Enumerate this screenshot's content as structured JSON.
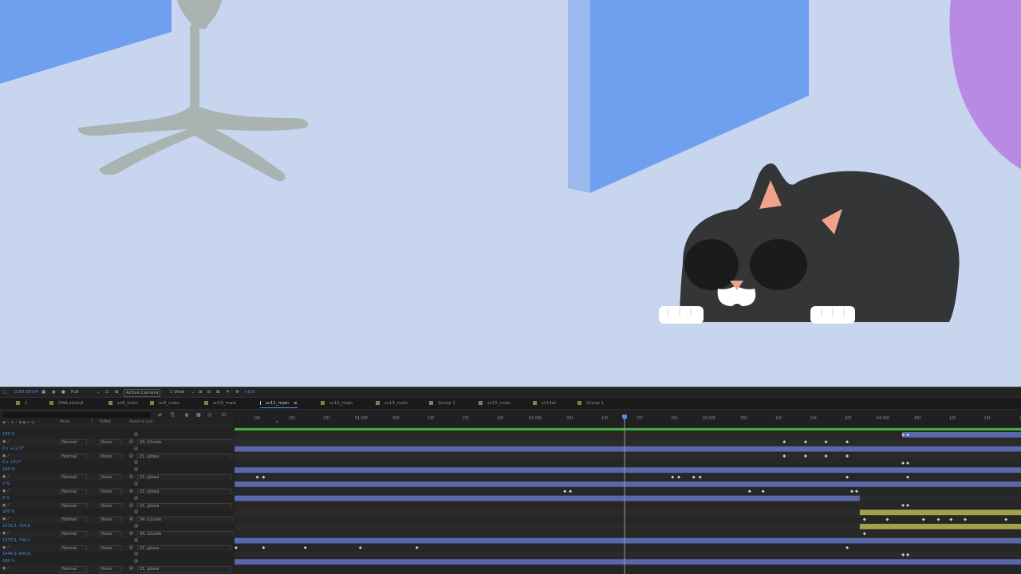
{
  "viewer": {
    "timecode": "0:00:00:04",
    "resolution": "Full",
    "camera": "Active Camera",
    "views": "1 View",
    "exposure": "+0,0"
  },
  "tabs": [
    {
      "label": "1"
    },
    {
      "label": "DNA.strand"
    },
    {
      "label": "sc8_main"
    },
    {
      "label": "sc9_main"
    },
    {
      "label": "sc10_main"
    },
    {
      "label": "sc11_main",
      "active": true
    },
    {
      "label": "sc12_main"
    },
    {
      "label": "sc13_main"
    },
    {
      "label": "Group 1"
    },
    {
      "label": "sc15_main"
    },
    {
      "label": "sc14el"
    },
    {
      "label": "Group 1"
    }
  ],
  "columns": {
    "mode": "Mode",
    "t": "T",
    "trkmat": "TrkMat",
    "parent": "Parent & Link"
  },
  "rows": [
    {
      "type": "prop",
      "value": "100 %"
    },
    {
      "type": "layer",
      "mode": "Normal",
      "trkmat": "None",
      "parent": "34. k2ciało"
    },
    {
      "type": "prop",
      "value": "0 x +12,0°"
    },
    {
      "type": "layer",
      "mode": "Normal",
      "trkmat": "None",
      "parent": "21. glowa"
    },
    {
      "type": "prop",
      "value": "0 x +0,0°"
    },
    {
      "type": "prop",
      "value": "100 %"
    },
    {
      "type": "layer",
      "mode": "Normal",
      "trkmat": "None",
      "parent": "21. glowa"
    },
    {
      "type": "prop",
      "value": "0 %"
    },
    {
      "type": "layer",
      "mode": "Normal",
      "trkmat": "None",
      "parent": "21. glowa"
    },
    {
      "type": "prop",
      "value": "0 %"
    },
    {
      "type": "layer",
      "mode": "Normal",
      "trkmat": "None",
      "parent": "21. glowa"
    },
    {
      "type": "prop",
      "value": "100 %"
    },
    {
      "type": "layer",
      "mode": "Normal",
      "trkmat": "None",
      "parent": "34. k2ciało"
    },
    {
      "type": "prop",
      "value": "1373,5, 754,6"
    },
    {
      "type": "layer",
      "mode": "Normal",
      "trkmat": "None",
      "parent": "34. k2ciało"
    },
    {
      "type": "prop",
      "value": "1373,6, 749,2"
    },
    {
      "type": "layer",
      "mode": "Normal",
      "trkmat": "None",
      "parent": "21. glowa"
    },
    {
      "type": "prop",
      "value": "1444,0, 844,0"
    },
    {
      "type": "prop",
      "value": "100 %"
    },
    {
      "type": "layer",
      "mode": "Normal",
      "trkmat": "None",
      "parent": "21. glowa"
    }
  ],
  "ruler_ticks": [
    "10f",
    "15f",
    "20f",
    "01:00f",
    "05f",
    "10f",
    "15f",
    "20f",
    "02:00f",
    "05f",
    "10f",
    "15f",
    "20f",
    "03:00f",
    "05f",
    "10f",
    "15f",
    "20f",
    "04:00f",
    "05f",
    "10f",
    "15f",
    "20"
  ],
  "timeline": {
    "playhead_frame": 4,
    "tracks": [
      {
        "bar": "blue",
        "start": 0.849,
        "end": 1.0,
        "keys": [
          0.85,
          0.856
        ]
      },
      {
        "bar": null,
        "keys": [
          0.699,
          0.726,
          0.752,
          0.779
        ]
      },
      {
        "bar": "blue",
        "start": 0.0,
        "end": 1.0,
        "keys": []
      },
      {
        "bar": null,
        "keys": [
          0.699,
          0.726,
          0.752,
          0.779
        ]
      },
      {
        "bar": null,
        "keys": [
          0.85,
          0.856
        ]
      },
      {
        "bar": "blue",
        "start": 0.0,
        "end": 1.0,
        "keys": []
      },
      {
        "bar": null,
        "keys": [
          0.029,
          0.037,
          0.557,
          0.565,
          0.584,
          0.592,
          0.779,
          0.856
        ]
      },
      {
        "bar": "blue",
        "start": 0.0,
        "end": 1.0,
        "keys": []
      },
      {
        "bar": null,
        "keys": [
          0.42,
          0.427,
          0.655,
          0.672,
          0.785,
          0.791
        ]
      },
      {
        "bar": "blue",
        "start": 0.0,
        "end": 0.795,
        "keys": []
      },
      {
        "bar": null,
        "keys": [
          0.85,
          0.856
        ]
      },
      {
        "bar": "yellow",
        "start": 0.795,
        "end": 1.0,
        "keys": []
      },
      {
        "bar": null,
        "keys": [
          0.801,
          0.83,
          0.876,
          0.895,
          0.911,
          0.929,
          0.981
        ]
      },
      {
        "bar": "yellow",
        "start": 0.795,
        "end": 1.0,
        "keys": []
      },
      {
        "bar": null,
        "keys": [
          0.801
        ]
      },
      {
        "bar": "blue",
        "start": 0.0,
        "end": 1.0,
        "keys": []
      },
      {
        "bar": null,
        "keys": [
          0.002,
          0.037,
          0.09,
          0.16,
          0.232,
          0.779
        ]
      },
      {
        "bar": null,
        "keys": [
          0.85,
          0.856
        ]
      },
      {
        "bar": "blue",
        "start": 0.0,
        "end": 1.0,
        "keys": []
      }
    ]
  },
  "colors": {
    "background": "#c7d5ef",
    "panel_blue": "#6fa0ef",
    "panel_side": "#9cb9ee",
    "cat_body": "#333536",
    "cat_ear": "#f0a28c",
    "purple": "#b98ae3",
    "chair": "#a9b4b2",
    "bar_blue": "#5a67a8",
    "bar_yellow": "#a3a14a",
    "accent": "#4d8cf0"
  }
}
